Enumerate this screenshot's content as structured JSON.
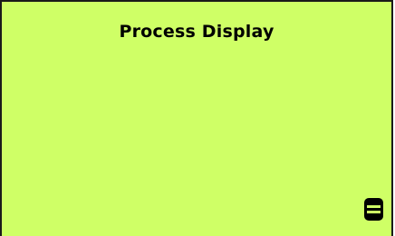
{
  "screen": {
    "title": "Process Display",
    "background_color": "#cfff66",
    "menu_icon": "menu-icon"
  }
}
